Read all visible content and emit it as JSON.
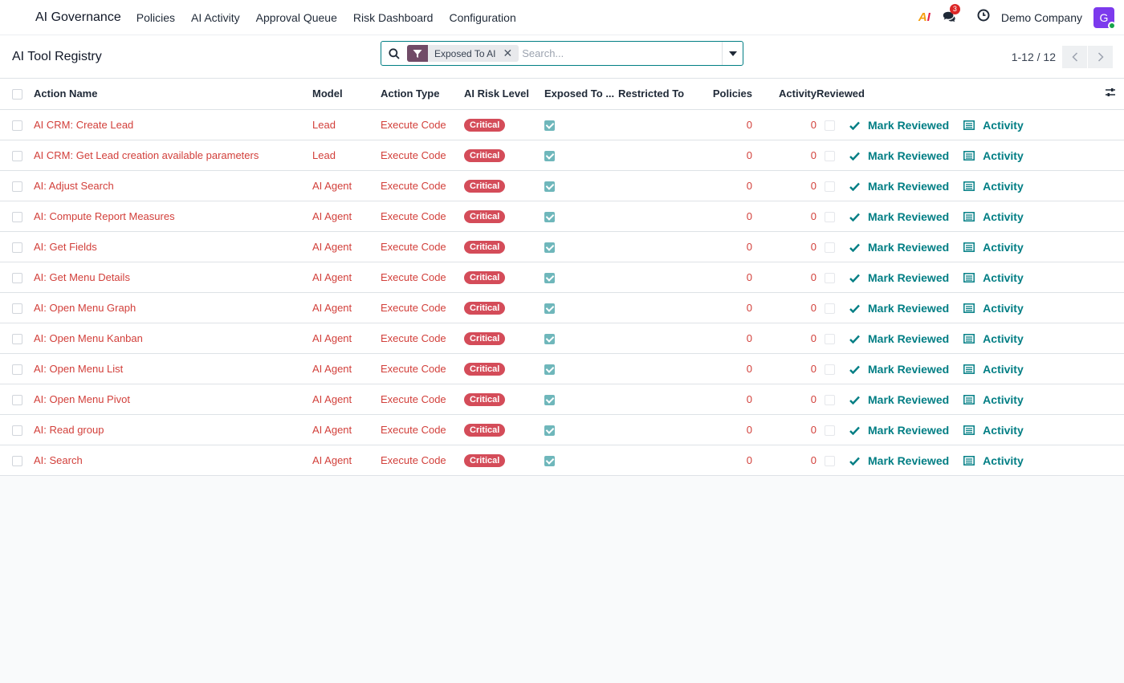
{
  "navbar": {
    "app_name": "AI Governance",
    "menu": [
      "Policies",
      "AI Activity",
      "Approval Queue",
      "Risk Dashboard",
      "Configuration"
    ],
    "ai_logo": "AI",
    "chat_count": "3",
    "company": "Demo Company",
    "avatar_initial": "G"
  },
  "control": {
    "title": "AI Tool Registry",
    "facet_label": "Exposed To AI",
    "search_placeholder": "Search...",
    "pager": "1-12 / 12"
  },
  "table": {
    "headers": {
      "action_name": "Action Name",
      "model": "Model",
      "action_type": "Action Type",
      "risk_level": "AI Risk Level",
      "exposed": "Exposed To ...",
      "restricted": "Restricted To",
      "policies": "Policies",
      "activity": "Activity",
      "reviewed": "Reviewed"
    },
    "mark_reviewed_label": "Mark Reviewed",
    "activity_label": "Activity",
    "rows": [
      {
        "name": "AI CRM: Create Lead",
        "model": "Lead",
        "type": "Execute Code",
        "risk": "Critical",
        "policies": "0",
        "activity": "0"
      },
      {
        "name": "AI CRM: Get Lead creation available parameters",
        "model": "Lead",
        "type": "Execute Code",
        "risk": "Critical",
        "policies": "0",
        "activity": "0"
      },
      {
        "name": "AI: Adjust Search",
        "model": "AI Agent",
        "type": "Execute Code",
        "risk": "Critical",
        "policies": "0",
        "activity": "0"
      },
      {
        "name": "AI: Compute Report Measures",
        "model": "AI Agent",
        "type": "Execute Code",
        "risk": "Critical",
        "policies": "0",
        "activity": "0"
      },
      {
        "name": "AI: Get Fields",
        "model": "AI Agent",
        "type": "Execute Code",
        "risk": "Critical",
        "policies": "0",
        "activity": "0"
      },
      {
        "name": "AI: Get Menu Details",
        "model": "AI Agent",
        "type": "Execute Code",
        "risk": "Critical",
        "policies": "0",
        "activity": "0"
      },
      {
        "name": "AI: Open Menu Graph",
        "model": "AI Agent",
        "type": "Execute Code",
        "risk": "Critical",
        "policies": "0",
        "activity": "0"
      },
      {
        "name": "AI: Open Menu Kanban",
        "model": "AI Agent",
        "type": "Execute Code",
        "risk": "Critical",
        "policies": "0",
        "activity": "0"
      },
      {
        "name": "AI: Open Menu List",
        "model": "AI Agent",
        "type": "Execute Code",
        "risk": "Critical",
        "policies": "0",
        "activity": "0"
      },
      {
        "name": "AI: Open Menu Pivot",
        "model": "AI Agent",
        "type": "Execute Code",
        "risk": "Critical",
        "policies": "0",
        "activity": "0"
      },
      {
        "name": "AI: Read group",
        "model": "AI Agent",
        "type": "Execute Code",
        "risk": "Critical",
        "policies": "0",
        "activity": "0"
      },
      {
        "name": "AI: Search",
        "model": "AI Agent",
        "type": "Execute Code",
        "risk": "Critical",
        "policies": "0",
        "activity": "0"
      }
    ]
  }
}
